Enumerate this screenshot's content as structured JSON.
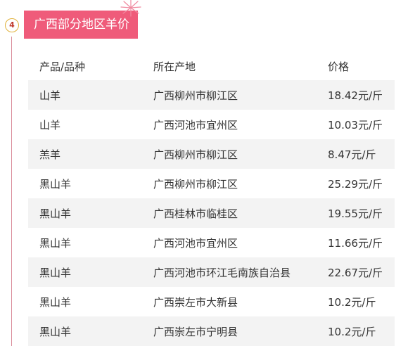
{
  "section": {
    "number": "4",
    "title": "广西部分地区羊价"
  },
  "table": {
    "headers": [
      "产品/品种",
      "所在产地",
      "价格"
    ],
    "rows": [
      [
        "山羊",
        "广西柳州市柳江区",
        "18.42元/斤"
      ],
      [
        "山羊",
        "广西河池市宜州区",
        "10.03元/斤"
      ],
      [
        "羔羊",
        "广西柳州市柳江区",
        "8.47元/斤"
      ],
      [
        "黑山羊",
        "广西柳州市柳江区",
        "25.29元/斤"
      ],
      [
        "黑山羊",
        "广西桂林市临桂区",
        "19.55元/斤"
      ],
      [
        "黑山羊",
        "广西河池市宜州区",
        "11.66元/斤"
      ],
      [
        "黑山羊",
        "广西河池市环江毛南族自治县",
        "22.67元/斤"
      ],
      [
        "黑山羊",
        "广西崇左市大新县",
        "10.2元/斤"
      ],
      [
        "黑山羊",
        "广西崇左市宁明县",
        "10.2元/斤"
      ]
    ]
  },
  "colors": {
    "title_bg": "#ef5b7a",
    "row_alt_bg": "#f3f3f3",
    "badge_border": "#e0b13a"
  }
}
